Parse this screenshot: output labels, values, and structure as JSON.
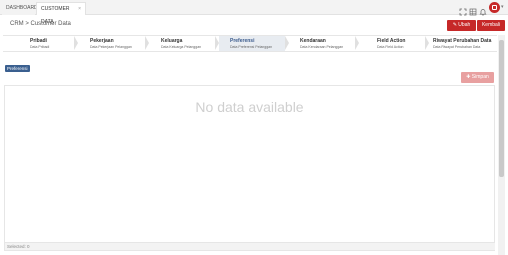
{
  "tabs": {
    "dashboard": "DASHBOARD",
    "customer": "CUSTOMER DATA",
    "close": "×"
  },
  "toolbar": {
    "icons": [
      "fullscreen-icon",
      "grid-icon",
      "bell-icon"
    ],
    "chevron": "▾"
  },
  "breadcrumb": "CRM > Customer Data",
  "actions": {
    "ubah": "✎ Ubah",
    "kembali": "Kembali"
  },
  "steps": [
    {
      "title": "Pribadi",
      "sub": "Data Pribadi"
    },
    {
      "title": "Pekerjaan",
      "sub": "Data Pekerjaan Pelanggan"
    },
    {
      "title": "Keluarga",
      "sub": "Data Keluarga Pelanggan"
    },
    {
      "title": "Preferensi",
      "sub": "Data Preferensi Pelanggan"
    },
    {
      "title": "Kendaraan",
      "sub": "Data Kendaraan Pelanggan"
    },
    {
      "title": "Field Action",
      "sub": "Data Field Action"
    },
    {
      "title": "Riwayat Perubahan Data",
      "sub": "Data Riwayat Perubahan Data"
    }
  ],
  "section": "Preferensi",
  "simpan": "✚ Simpan",
  "grid": {
    "empty": "No data available",
    "selected": "Selected: 0"
  },
  "colors": {
    "accent": "#c62828",
    "section": "#3a5f8f"
  }
}
